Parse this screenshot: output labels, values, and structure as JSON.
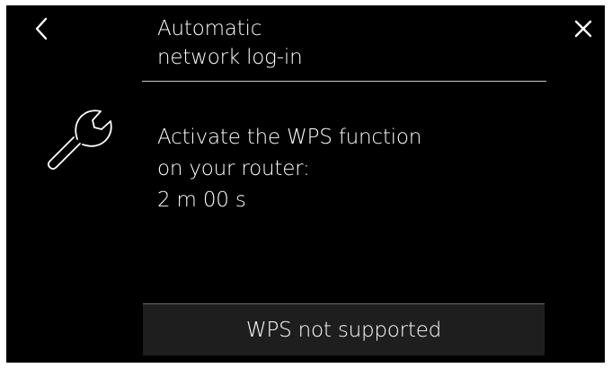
{
  "header": {
    "title_line1": "Automatic",
    "title_line2": "network log-in",
    "back_icon": "chevron-left-icon",
    "close_icon": "close-icon"
  },
  "main": {
    "icon": "wrench-icon",
    "message_line1": "Activate the WPS function",
    "message_line2": "on your router:",
    "countdown": "2 m 00 s"
  },
  "footer": {
    "button_label": "WPS not supported"
  },
  "colors": {
    "background": "#000000",
    "text": "#ffffff",
    "button_background": "#1e1e1e",
    "divider": "#c8c8c8"
  }
}
